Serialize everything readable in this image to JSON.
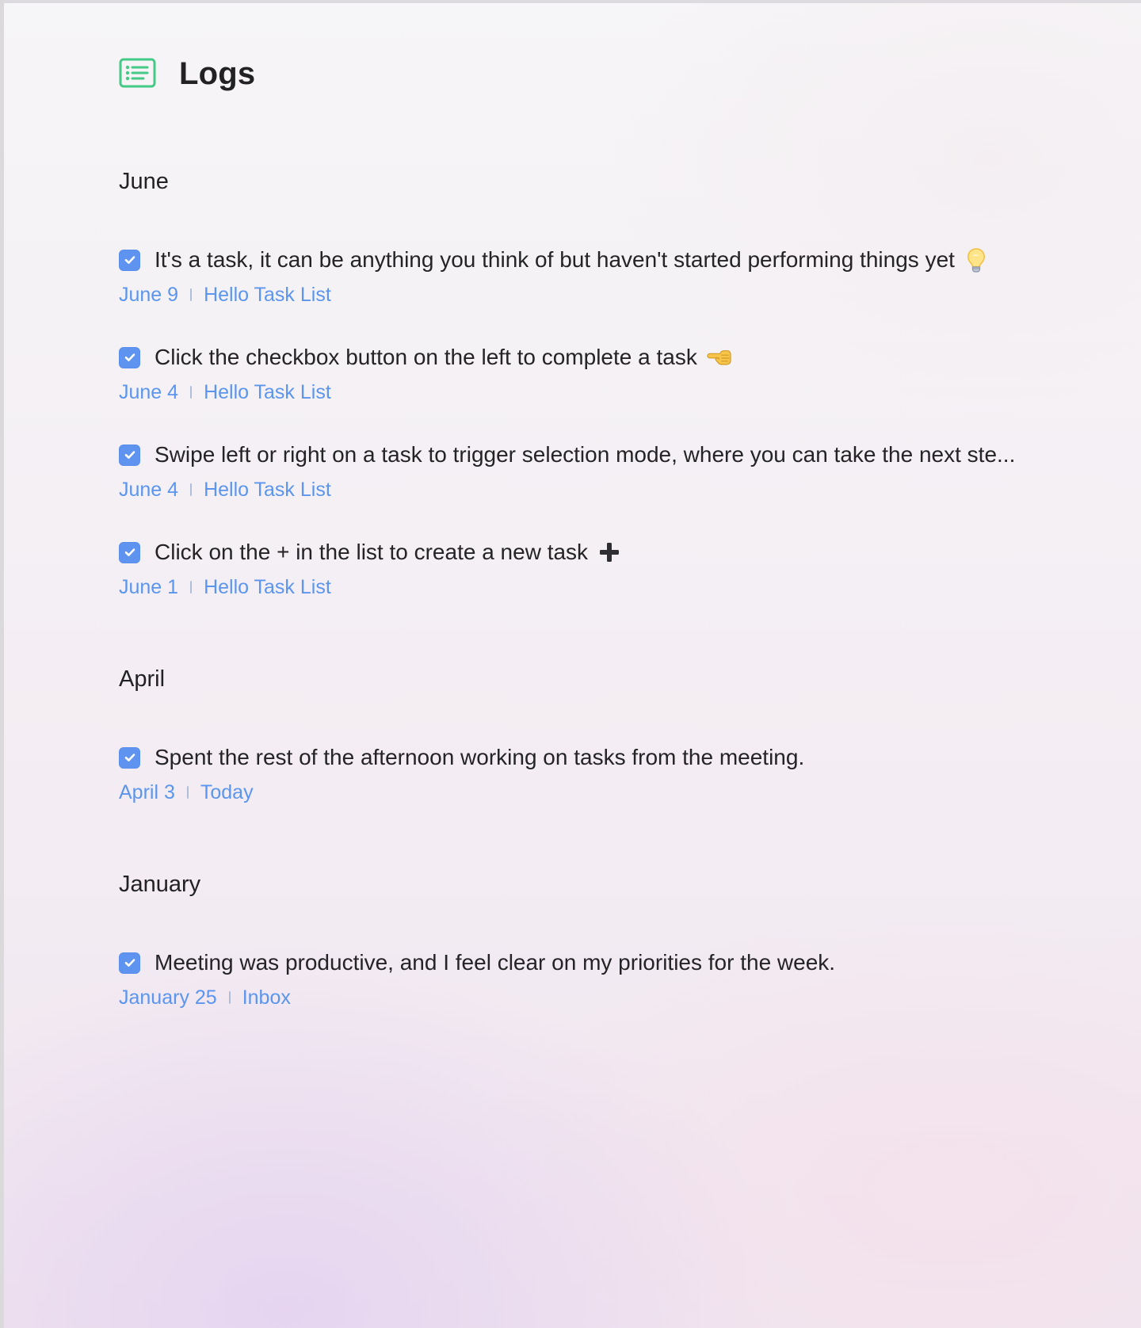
{
  "page": {
    "title": "Logs",
    "icon": "list-icon",
    "accent_color": "#5F93F0",
    "icon_color": "#45C986"
  },
  "sections": [
    {
      "month": "June",
      "tasks": [
        {
          "text": "It's a task, it can be anything you think of but haven't started performing things yet",
          "emoji": "💡",
          "emoji_icon": "lightbulb-icon",
          "date": "June 9",
          "list": "Hello Task List",
          "completed": true
        },
        {
          "text": "Click the checkbox button on the left to complete a task",
          "emoji": "👈",
          "emoji_icon": "pointing-left-icon",
          "date": "June 4",
          "list": "Hello Task List",
          "completed": true
        },
        {
          "text": "Swipe left or right on a task to trigger selection mode, where you can take the next ste...",
          "date": "June 4",
          "list": "Hello Task List",
          "completed": true
        },
        {
          "text": "Click on the + in the list to create a new task",
          "emoji": "➕",
          "emoji_icon": "plus-icon",
          "date": "June 1",
          "list": "Hello Task List",
          "completed": true
        }
      ]
    },
    {
      "month": "April",
      "tasks": [
        {
          "text": "Spent the rest of the afternoon working on tasks from the meeting.",
          "date": "April 3",
          "list": "Today",
          "completed": true
        }
      ]
    },
    {
      "month": "January",
      "tasks": [
        {
          "text": "Meeting was productive, and I feel clear on my priorities for the week.",
          "date": "January 25",
          "list": "Inbox",
          "completed": true
        }
      ]
    }
  ]
}
